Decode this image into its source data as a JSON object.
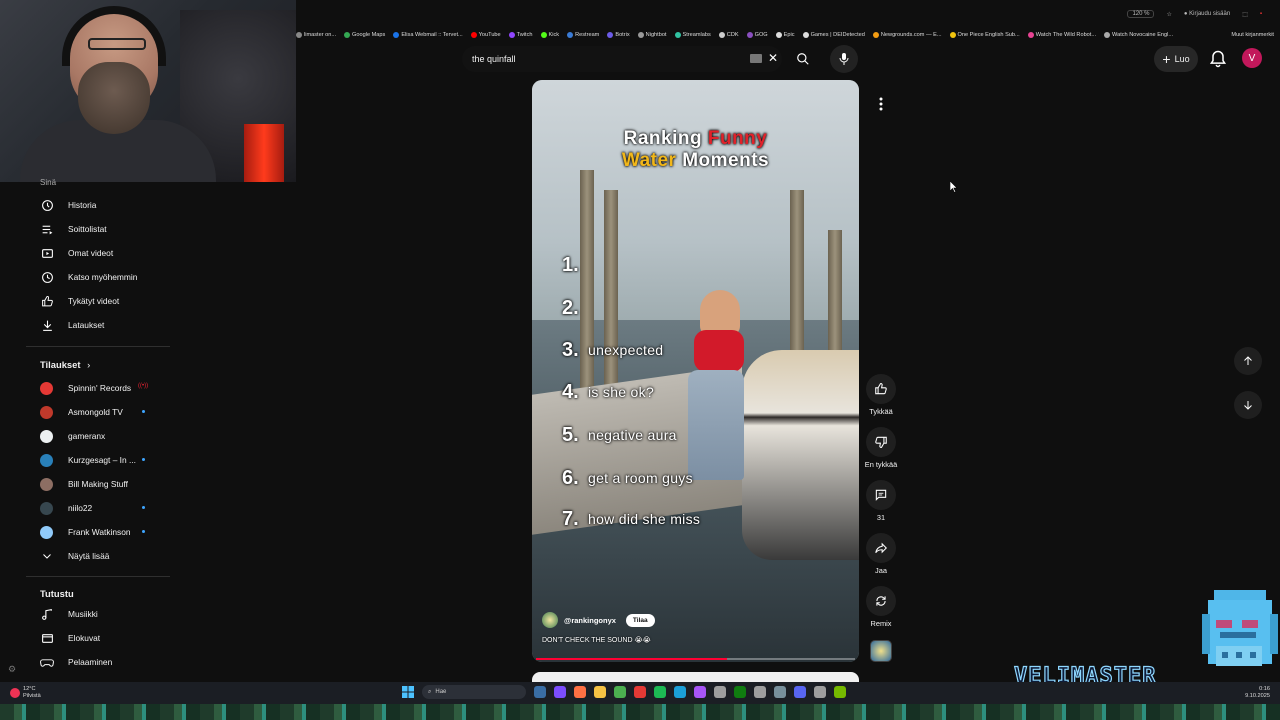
{
  "browser": {
    "zoom": "120 %",
    "signin": "Kirjaudu sisään",
    "bookmarks": [
      {
        "label": "limaster on...",
        "color": "#888888"
      },
      {
        "label": "Google Maps",
        "color": "#34a853"
      },
      {
        "label": "Elisa Webmail :: Tervet...",
        "color": "#1a73e8"
      },
      {
        "label": "YouTube",
        "color": "#ff0000"
      },
      {
        "label": "Twitch",
        "color": "#9146ff"
      },
      {
        "label": "Kick",
        "color": "#53fc18"
      },
      {
        "label": "Restream",
        "color": "#3a7bd5"
      },
      {
        "label": "Botrix",
        "color": "#6c5ce7"
      },
      {
        "label": "Nightbot",
        "color": "#999999"
      },
      {
        "label": "Streamlabs",
        "color": "#31c3a2"
      },
      {
        "label": "CDK",
        "color": "#cccccc"
      },
      {
        "label": "GOG",
        "color": "#8a4fbf"
      },
      {
        "label": "Epic",
        "color": "#dddddd"
      },
      {
        "label": "Games | DEIDetected",
        "color": "#dddddd"
      },
      {
        "label": "Newgrounds.com — E...",
        "color": "#f39c12"
      },
      {
        "label": "One Piece English Sub...",
        "color": "#f1c40f"
      },
      {
        "label": "Watch The Wild Robot...",
        "color": "#e84393"
      },
      {
        "label": "Watch Novocaine Engl...",
        "color": "#aaaaaa"
      }
    ],
    "other_bookmarks": "Muut kirjanmerkit"
  },
  "header": {
    "search_value": "the quinfall",
    "create_label": "Luo",
    "avatar_letter": "V",
    "avatar_color": "#c2185b"
  },
  "sidebar": {
    "you_section_cut": "Sinä",
    "you_items": [
      {
        "label": "Historia",
        "icon": "history-icon"
      },
      {
        "label": "Soittolistat",
        "icon": "playlists-icon"
      },
      {
        "label": "Omat videot",
        "icon": "your-videos-icon"
      },
      {
        "label": "Katso myöhemmin",
        "icon": "watch-later-icon"
      },
      {
        "label": "Tykätyt videot",
        "icon": "liked-videos-icon"
      },
      {
        "label": "Lataukset",
        "icon": "downloads-icon"
      }
    ],
    "subscriptions_title": "Tilaukset",
    "subscriptions": [
      {
        "label": "Spinnin' Records",
        "color": "#e53935",
        "indicator": "live"
      },
      {
        "label": "Asmongold TV",
        "color": "#c0392b",
        "indicator": "dot"
      },
      {
        "label": "gameranx",
        "color": "#ecf0f1",
        "indicator": "none"
      },
      {
        "label": "Kurzgesagt – In ...",
        "color": "#2980b9",
        "indicator": "dot"
      },
      {
        "label": "Bill Making Stuff",
        "color": "#8d6e63",
        "indicator": "none"
      },
      {
        "label": "niilo22",
        "color": "#37474f",
        "indicator": "dot"
      },
      {
        "label": "Frank Watkinson",
        "color": "#90caf9",
        "indicator": "dot"
      }
    ],
    "show_more": "Näytä lisää",
    "explore_title": "Tutustu",
    "explore_items": [
      {
        "label": "Musiikki",
        "icon": "music-icon"
      },
      {
        "label": "Elokuvat",
        "icon": "movies-icon"
      },
      {
        "label": "Pelaaminen",
        "icon": "gaming-icon"
      }
    ]
  },
  "short": {
    "title_line1": "Ranking",
    "title_line1_highlight": "Funny",
    "title_line2_highlight": "Water",
    "title_line2": "Moments",
    "ranks": [
      {
        "num": "1.",
        "text": ""
      },
      {
        "num": "2.",
        "text": ""
      },
      {
        "num": "3.",
        "text": "unexpected"
      },
      {
        "num": "4.",
        "text": "is she ok?"
      },
      {
        "num": "5.",
        "text": "negative aura"
      },
      {
        "num": "6.",
        "text": "get a room guys"
      },
      {
        "num": "7.",
        "text": "how did she miss"
      }
    ],
    "channel": "@rankingonyx",
    "subscribe_label": "Tilaa",
    "caption": "DON'T CHECK THE SOUND 😭😭",
    "progress": 0.6
  },
  "actions": {
    "like_label": "Tykkää",
    "dislike_label": "En tykkää",
    "comments_count": "31",
    "share_label": "Jaa",
    "remix_label": "Remix"
  },
  "overlay": {
    "streamer_name": "VELIMASTER"
  },
  "taskbar": {
    "weather_temp": "12°C",
    "weather_desc": "Pilvistä",
    "search_placeholder": "Hae",
    "time": "0:16",
    "date": "9.10.2025",
    "apps": [
      "#3a6ea5",
      "#7c4dff",
      "#ff7043",
      "#f6c244",
      "#4caf50",
      "#e53935",
      "#1db954",
      "#1b9fd8",
      "#a855f7",
      "#9e9e9e",
      "#107c10",
      "#9e9e9e",
      "#78909c",
      "#5865f2",
      "#9e9e9e",
      "#76b900"
    ]
  }
}
